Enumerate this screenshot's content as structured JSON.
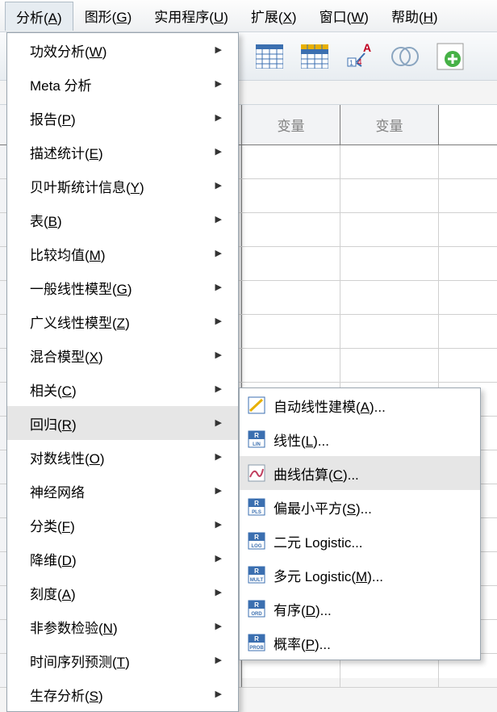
{
  "menubar": {
    "items": [
      {
        "label": "分析",
        "mnemonic": "A"
      },
      {
        "label": "图形",
        "mnemonic": "G"
      },
      {
        "label": "实用程序",
        "mnemonic": "U"
      },
      {
        "label": "扩展",
        "mnemonic": "X"
      },
      {
        "label": "窗口",
        "mnemonic": "W"
      },
      {
        "label": "帮助",
        "mnemonic": "H"
      }
    ]
  },
  "grid": {
    "header_partial": "量",
    "header": "变量",
    "rows": 16
  },
  "dropdown": {
    "items": [
      {
        "label": "功效分析",
        "mnemonic": "W",
        "sub": true
      },
      {
        "label": "Meta 分析",
        "mnemonic": "",
        "sub": true
      },
      {
        "label": "报告",
        "mnemonic": "P",
        "sub": true
      },
      {
        "label": "描述统计",
        "mnemonic": "E",
        "sub": true
      },
      {
        "label": "贝叶斯统计信息",
        "mnemonic": "Y",
        "sub": true
      },
      {
        "label": "表",
        "mnemonic": "B",
        "sub": true
      },
      {
        "label": "比较均值",
        "mnemonic": "M",
        "sub": true
      },
      {
        "label": "一般线性模型",
        "mnemonic": "G",
        "sub": true
      },
      {
        "label": "广义线性模型",
        "mnemonic": "Z",
        "sub": true
      },
      {
        "label": "混合模型",
        "mnemonic": "X",
        "sub": true
      },
      {
        "label": "相关",
        "mnemonic": "C",
        "sub": true
      },
      {
        "label": "回归",
        "mnemonic": "R",
        "sub": true,
        "hover": true
      },
      {
        "label": "对数线性",
        "mnemonic": "O",
        "sub": true
      },
      {
        "label": "神经网络",
        "mnemonic": "",
        "sub": true
      },
      {
        "label": "分类",
        "mnemonic": "F",
        "sub": true
      },
      {
        "label": "降维",
        "mnemonic": "D",
        "sub": true
      },
      {
        "label": "刻度",
        "mnemonic": "A",
        "sub": true
      },
      {
        "label": "非参数检验",
        "mnemonic": "N",
        "sub": true
      },
      {
        "label": "时间序列预测",
        "mnemonic": "T",
        "sub": true
      },
      {
        "label": "生存分析",
        "mnemonic": "S",
        "sub": true
      }
    ]
  },
  "submenu": {
    "items": [
      {
        "icon": "auto-linear-icon",
        "label": "自动线性建模",
        "mnemonic": "A",
        "ell": true,
        "color": "#3f6fb8"
      },
      {
        "icon": "r-lin-icon",
        "label": "线性",
        "mnemonic": "L",
        "ell": true,
        "badge": "R\nLIN"
      },
      {
        "icon": "curve-icon",
        "label": "曲线估算",
        "mnemonic": "C",
        "ell": true,
        "hover": true
      },
      {
        "icon": "r-pls-icon",
        "label": "偏最小平方",
        "mnemonic": "S",
        "ell": true,
        "badge": "R\nPLS"
      },
      {
        "icon": "r-log-icon",
        "label": "二元 Logistic",
        "mnemonic": "",
        "ell": true,
        "badge": "R\nLOG"
      },
      {
        "icon": "r-mult-icon",
        "label": "多元 Logistic",
        "mnemonic": "M",
        "ell": true,
        "badge": "R\nMULT"
      },
      {
        "icon": "r-ord-icon",
        "label": "有序",
        "mnemonic": "D",
        "ell": true,
        "badge": "R\nORD"
      },
      {
        "icon": "r-prob-icon",
        "label": "概率",
        "mnemonic": "P",
        "ell": true,
        "badge": "R\nPROB"
      }
    ]
  },
  "icons": {
    "grid1": "grid-icon",
    "grid2": "grid-highlight-icon",
    "a14": "label-a-icon",
    "venn": "venn-icon",
    "add": "add-icon"
  }
}
